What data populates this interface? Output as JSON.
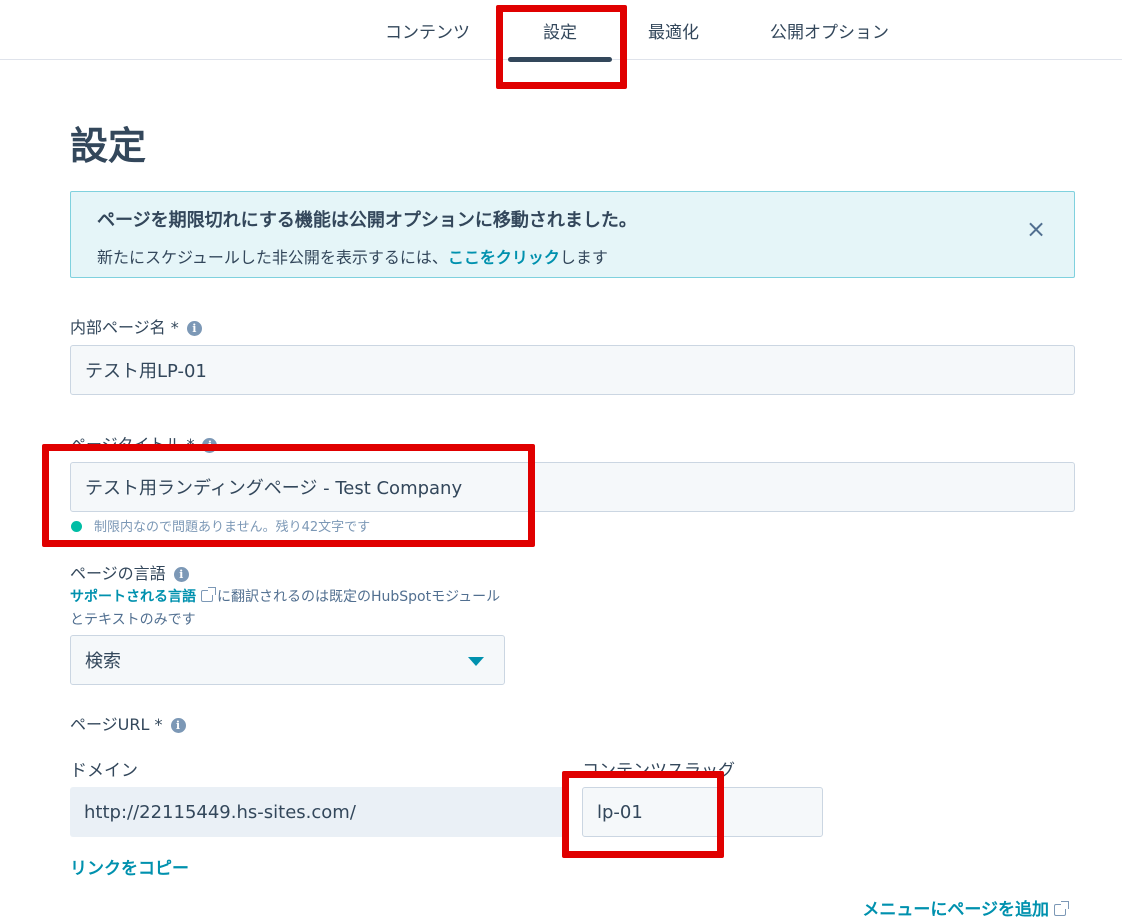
{
  "tabs": {
    "content": "コンテンツ",
    "settings": "設定",
    "optimize": "最適化",
    "publish_options": "公開オプション"
  },
  "page_title": "設定",
  "alert": {
    "title": "ページを期限切れにする機能は公開オプションに移動されました。",
    "body_prefix": "新たにスケジュールした非公開を表示するには、",
    "link_text": "ここをクリック",
    "body_suffix": "します",
    "close_icon": "×"
  },
  "internal_name": {
    "label": "内部ページ名 *",
    "value": "テスト用LP-01"
  },
  "page_title_field": {
    "label": "ページタイトル *",
    "value": "テスト用ランディングページ - Test Company",
    "hint": "制限内なので問題ありません。残り42文字です"
  },
  "language": {
    "label": "ページの言語",
    "help_link": "サポートされる言語",
    "help_text": "に翻訳されるのは既定のHubSpotモジュールとテキストのみです",
    "selected": "検索"
  },
  "url": {
    "label": "ページURL *",
    "domain_label": "ドメイン",
    "domain_value": "http://22115449.hs-sites.com/",
    "slug_label": "コンテンツスラッグ",
    "slug_value": "lp-01",
    "copy_link": "リンクをコピー",
    "add_to_menu": "メニューにページを追加"
  },
  "colors": {
    "accent": "#0091ae",
    "text": "#33475b",
    "highlight": "#e00000",
    "success": "#00bda5"
  }
}
